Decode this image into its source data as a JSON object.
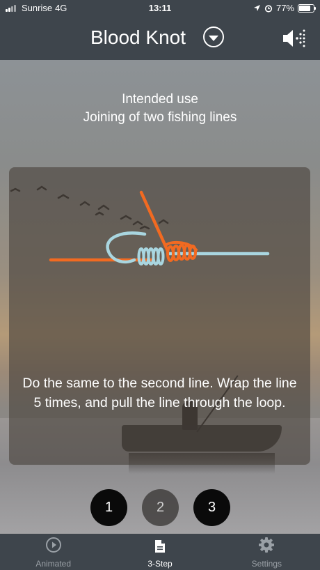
{
  "status_bar": {
    "carrier": "Sunrise",
    "network": "4G",
    "time": "13:11",
    "battery": "77%"
  },
  "header": {
    "title": "Blood Knot",
    "dropdown_icon": "chevron-down-circle-icon",
    "sound_icon": "speaker-icon"
  },
  "intended_use": {
    "heading": "Intended use",
    "text": "Joining of two fishing lines"
  },
  "instruction": "Do the same to the second line. Wrap the line 5 times, and pull the line through the loop.",
  "steps": [
    {
      "label": "1",
      "selected": false
    },
    {
      "label": "2",
      "selected": true
    },
    {
      "label": "3",
      "selected": false
    }
  ],
  "tabs": [
    {
      "label": "Animated",
      "icon": "play-circle-icon",
      "active": false
    },
    {
      "label": "3-Step",
      "icon": "document-icon",
      "active": true
    },
    {
      "label": "Settings",
      "icon": "gear-icon",
      "active": false
    }
  ],
  "colors": {
    "bar_bg": "#3e454c",
    "line_orange": "#f26a21",
    "line_blue": "#a9d6e0"
  }
}
